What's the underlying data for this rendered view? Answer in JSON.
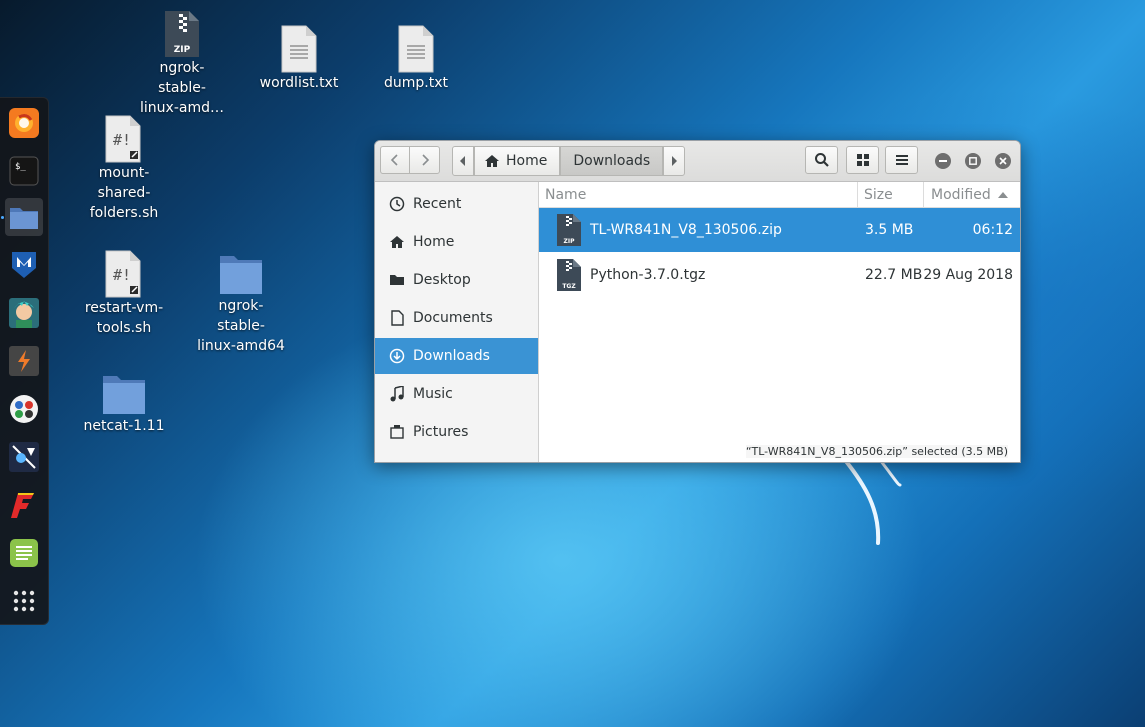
{
  "desktop": {
    "icons": [
      {
        "label": "ngrok-\nstable-\nlinux-amd…",
        "type": "zip-archive"
      },
      {
        "label": "wordlist.txt",
        "type": "text-file"
      },
      {
        "label": "dump.txt",
        "type": "text-file"
      },
      {
        "label": "mount-\nshared-\nfolders.sh",
        "type": "shell-script"
      },
      {
        "label": "restart-vm-\ntools.sh",
        "type": "shell-script"
      },
      {
        "label": "ngrok-\nstable-\nlinux-amd64",
        "type": "folder"
      },
      {
        "label": "netcat-1.11",
        "type": "folder"
      }
    ]
  },
  "dock": {
    "items": [
      "firefox-icon",
      "terminal-icon",
      "files-icon",
      "metasploit-icon",
      "armitage-icon",
      "burpsuite-icon",
      "maltego-icon",
      "beef-icon",
      "faraday-icon",
      "text-editor-icon",
      "show-apps-icon"
    ],
    "active": "files-icon"
  },
  "window": {
    "breadcrumbs": [
      "Home",
      "Downloads"
    ],
    "current": "Downloads",
    "sidebar": [
      {
        "label": "Recent",
        "icon": "clock-icon"
      },
      {
        "label": "Home",
        "icon": "home-icon"
      },
      {
        "label": "Desktop",
        "icon": "desktop-icon"
      },
      {
        "label": "Documents",
        "icon": "document-icon"
      },
      {
        "label": "Downloads",
        "icon": "download-icon",
        "selected": true
      },
      {
        "label": "Music",
        "icon": "music-icon"
      },
      {
        "label": "Pictures",
        "icon": "camera-icon"
      }
    ],
    "columns": {
      "name": "Name",
      "size": "Size",
      "modified": "Modified"
    },
    "files": [
      {
        "name": "TL-WR841N_V8_130506.zip",
        "size": "3.5 MB",
        "modified": "06:12",
        "badge": "ZIP",
        "selected": true
      },
      {
        "name": "Python-3.7.0.tgz",
        "size": "22.7 MB",
        "modified": "29 Aug 2018",
        "badge": "TGZ"
      }
    ],
    "status": "“TL-WR841N_V8_130506.zip” selected  (3.5 MB)"
  },
  "colors": {
    "selection": "#2f8fd6",
    "sidebar_selection": "#3a93d4"
  }
}
